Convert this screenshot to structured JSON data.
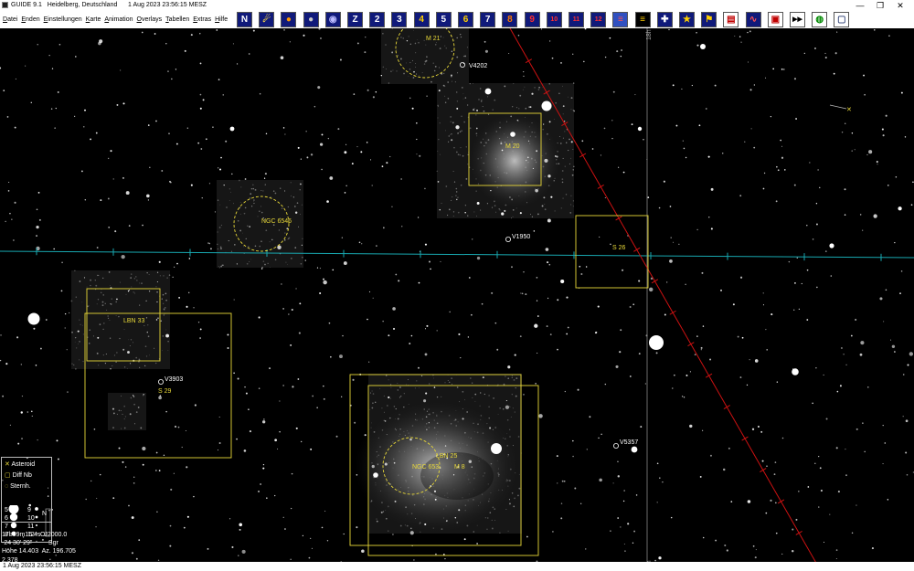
{
  "window": {
    "app_title": "GUIDE 9.1",
    "location": "Heidelberg, Deutschland",
    "datetime": "1 Aug 2023 23:56:15 MESZ",
    "minimize": "—",
    "restore": "❐",
    "close": "✕"
  },
  "menu": [
    {
      "key": "D",
      "rest": "atei"
    },
    {
      "key": "E",
      "rest": "nden"
    },
    {
      "key": "E",
      "rest": "instellungen"
    },
    {
      "key": "K",
      "rest": "arte"
    },
    {
      "key": "A",
      "rest": "nimation"
    },
    {
      "key": "O",
      "rest": "verlays"
    },
    {
      "key": "T",
      "rest": "abellen"
    },
    {
      "key": "E",
      "rest": "xtras"
    },
    {
      "key": "H",
      "rest": "ilfe"
    }
  ],
  "toolbar": [
    {
      "icon": "north-level-icon",
      "glyph": "N",
      "bg": "#101a7a",
      "fg": "#ffffff"
    },
    {
      "icon": "star-level-icon",
      "glyph": "☄",
      "bg": "#101a7a",
      "fg": "#ffdd44"
    },
    {
      "icon": "sun-icon",
      "glyph": "●",
      "bg": "#101a7a",
      "fg": "#ff9a00"
    },
    {
      "icon": "moon-icon",
      "glyph": "●",
      "bg": "#101a7a",
      "fg": "#c8c8c8"
    },
    {
      "icon": "planet-icon",
      "glyph": "◉",
      "bg": "#101a7a",
      "fg": "#bbbbff"
    },
    {
      "icon": "zoom-z-icon",
      "glyph": "Z",
      "bg": "#101a7a",
      "fg": "#ffffff"
    },
    {
      "icon": "level-2-icon",
      "glyph": "2",
      "bg": "#101a7a",
      "fg": "#ffffff"
    },
    {
      "icon": "level-3-icon",
      "glyph": "3",
      "bg": "#101a7a",
      "fg": "#ffffff"
    },
    {
      "icon": "level-4-icon",
      "glyph": "4",
      "bg": "#101a7a",
      "fg": "#ffd000"
    },
    {
      "icon": "level-5-icon",
      "glyph": "5",
      "bg": "#101a7a",
      "fg": "#ffffff"
    },
    {
      "icon": "level-6-icon",
      "glyph": "6",
      "bg": "#101a7a",
      "fg": "#ffd000"
    },
    {
      "icon": "level-7-icon",
      "glyph": "7",
      "bg": "#101a7a",
      "fg": "#ffffff"
    },
    {
      "icon": "level-8-icon",
      "glyph": "8",
      "bg": "#101a7a",
      "fg": "#ff7a00"
    },
    {
      "icon": "level-9-icon",
      "glyph": "9",
      "bg": "#101a7a",
      "fg": "#ff3030"
    },
    {
      "icon": "level-10-icon",
      "glyph": "10",
      "bg": "#101a7a",
      "fg": "#ff3030"
    },
    {
      "icon": "level-11-icon",
      "glyph": "11",
      "bg": "#101a7a",
      "fg": "#ff3030"
    },
    {
      "icon": "level-12-icon",
      "glyph": "12",
      "bg": "#101a7a",
      "fg": "#ff3030"
    },
    {
      "icon": "us-flag-icon",
      "glyph": "≡",
      "bg": "#3050c0",
      "fg": "#ff5050"
    },
    {
      "icon": "german-flag-icon",
      "glyph": "≡",
      "bg": "#000000",
      "fg": "#ffcc00"
    },
    {
      "icon": "cross-icon",
      "glyph": "✚",
      "bg": "#101a7a",
      "fg": "#ffffff"
    },
    {
      "icon": "eu-flag-icon",
      "glyph": "★",
      "bg": "#101a7a",
      "fg": "#ffd000"
    },
    {
      "icon": "telescope-icon",
      "glyph": "⚑",
      "bg": "#101a7a",
      "fg": "#ffd000"
    },
    {
      "icon": "document-icon",
      "glyph": "▤",
      "bg": "#ffffff",
      "fg": "#c00000"
    },
    {
      "icon": "chart-icon",
      "glyph": "∿",
      "bg": "#101a7a",
      "fg": "#ff5050"
    },
    {
      "icon": "record-icon",
      "glyph": "▣",
      "bg": "#ffffff",
      "fg": "#c00000"
    },
    {
      "icon": "fast-forward-icon",
      "glyph": "▶▶",
      "bg": "#ffffff",
      "fg": "#000000"
    },
    {
      "icon": "globe-icon",
      "glyph": "◍",
      "bg": "#ffffff",
      "fg": "#008800"
    },
    {
      "icon": "window-icon",
      "glyph": "▢",
      "bg": "#ffffff",
      "fg": "#405080"
    }
  ],
  "sky": {
    "ra_hour_label": "18h",
    "colors": {
      "dso": "#e8d838",
      "ecliptic": "#cc1111",
      "equator_line": "#18a8b0",
      "star": "#ffffff",
      "ra_line": "#888888"
    },
    "objects": [
      {
        "id": "m21",
        "label": "M 21"
      },
      {
        "id": "m20",
        "label": "M 20"
      },
      {
        "id": "ngc6546",
        "label": "NGC 6546"
      },
      {
        "id": "s26",
        "label": "S 26"
      },
      {
        "id": "lbn33",
        "label": "LBN 33"
      },
      {
        "id": "s29",
        "label": "S 29"
      },
      {
        "id": "lbn25",
        "label": "LBN 25"
      },
      {
        "id": "ngc6530",
        "label": "NGC 653"
      },
      {
        "id": "m8",
        "label": "M 8"
      }
    ],
    "variables": [
      {
        "id": "v4202",
        "label": "V4202"
      },
      {
        "id": "v1950",
        "label": "V1950"
      },
      {
        "id": "v3903",
        "label": "V3903"
      },
      {
        "id": "v5357",
        "label": "V5357"
      }
    ]
  },
  "legend": {
    "entries": [
      {
        "icon": "asteroid-icon",
        "glyph": "✕",
        "label": "Asteroid"
      },
      {
        "icon": "diffuse-nebula-icon",
        "glyph": "▢",
        "label": "Diff Nb"
      },
      {
        "icon": "star-cluster-icon",
        "glyph": "◌",
        "label": "Sternh."
      }
    ],
    "magnitudes": [
      "5",
      "6",
      "7",
      "8",
      "9",
      "10",
      "11",
      "12"
    ],
    "compass_n": "N",
    "compass_o": "O"
  },
  "info": {
    "ra": "17h59m16.4s",
    "epoch": "J2000.0",
    "dec": "-24 30' 29\"",
    "constellation": "Sgr",
    "altaz": "Höhe 14.403  Az. 196.705",
    "fov": "2.378",
    "datetime": "1 Aug 2023 23:56:15 MESZ"
  }
}
